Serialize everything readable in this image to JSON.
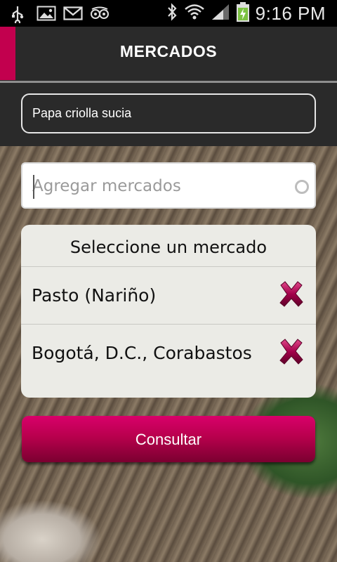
{
  "status_bar": {
    "time": "9:16 PM",
    "left_icons": [
      "usb-icon",
      "gallery-icon",
      "gmail-icon",
      "tripadvisor-owl-icon"
    ],
    "right_icons": [
      "bluetooth-icon",
      "wifi-icon",
      "signal-icon",
      "battery-charging-icon"
    ]
  },
  "header": {
    "title": "MERCADOS",
    "accent_color": "#c2004e"
  },
  "product": {
    "value": "Papa criolla sucia"
  },
  "add_market": {
    "placeholder": "Agregar mercados"
  },
  "panel": {
    "title": "Seleccione un mercado",
    "markets": [
      {
        "label": "Pasto (Nariño)"
      },
      {
        "label": "Bogotá, D.C., Corabastos"
      }
    ]
  },
  "actions": {
    "consultar_label": "Consultar",
    "button_color": "#b8004d"
  }
}
